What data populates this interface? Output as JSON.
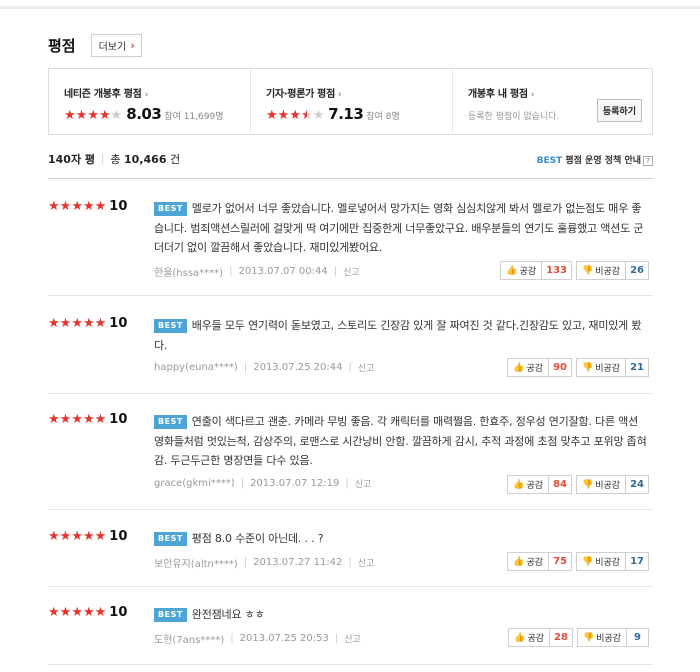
{
  "section": {
    "title": "평점",
    "more_label": "더보기"
  },
  "summary": {
    "netizen": {
      "label": "네티즌 개봉후 평점",
      "score": "8.03",
      "count": "참여 11,699명",
      "stars": [
        "full",
        "full",
        "full",
        "full",
        "empty"
      ]
    },
    "critic": {
      "label": "기자·평론가 평점",
      "score": "7.13",
      "count": "참여 8명",
      "stars": [
        "full",
        "full",
        "full",
        "half",
        "empty"
      ]
    },
    "mine": {
      "label": "개봉후 내 평점",
      "text": "등록한 평점이 없습니다.",
      "button": "등록하기"
    }
  },
  "list_info": {
    "type": "140자 평",
    "total_prefix": "총",
    "total": "10,466",
    "total_unit": "건",
    "best_word": "BEST",
    "policy": "평점 운영 정책 안내",
    "help": "?"
  },
  "colors": {
    "star_on": "#e8322b",
    "star_off": "#cccccc",
    "best_badge": "#4ca5d4",
    "agree_num": "#e34d3a",
    "disagree_num": "#2e6b9c"
  },
  "vote_labels": {
    "agree": "공감",
    "disagree": "비공감",
    "report": "신고"
  },
  "reviews": [
    {
      "score": "10",
      "badge": "BEST",
      "text": "멜로가 없어서 너무 좋았습니다. 멜로넣어서 망가지는 영화 심심치않게 봐서 멜로가 없는점도 매우 좋습니다. 범죄액션스릴러에 걸맞게 딱 여기에만 집중한게 너무좋았구요. 배우분들의 연기도 훌륭했고 액션도 군더더기 없이 깔끔해서 좋았습니다. 재미있게봤어요.",
      "author": "한울(hssa****)",
      "date": "2013.07.07 00:44",
      "agree": "133",
      "disagree": "26"
    },
    {
      "score": "10",
      "badge": "BEST",
      "text": "배우들 모두 연기력이 돋보였고, 스토리도 긴장감 있게 잘 짜여진 것 같다.긴장감도 있고, 재미있게 봤다.",
      "author": "happy(euna****)",
      "date": "2013.07.25 20:44",
      "agree": "90",
      "disagree": "21"
    },
    {
      "score": "10",
      "badge": "BEST",
      "text": "연출이 색다르고 괜춘. 카메라 무빙 좋음. 각 캐릭터를 매력쩔음. 한효주, 정우성 연기잘함. 다른 액션 영화들처럼 멋있는척, 감상주의, 로맨스로 시간낭비 안함. 깔끔하게 감시, 추적 과정에 초점 맞추고 포위망 좁혀감. 두근두근한 명장면들 다수 있음.",
      "author": "grace(gkmi****)",
      "date": "2013.07.07 12:19",
      "agree": "84",
      "disagree": "24"
    },
    {
      "score": "10",
      "badge": "BEST",
      "text": "평점 8.0 수준이 아닌데. . . ?",
      "author": "보안유지(altn****)",
      "date": "2013.07.27 11:42",
      "agree": "75",
      "disagree": "17"
    },
    {
      "score": "10",
      "badge": "BEST",
      "text": "완전잼네요 ㅎㅎ",
      "author": "도현(7ans****)",
      "date": "2013.07.25 20:53",
      "agree": "28",
      "disagree": "9"
    }
  ]
}
